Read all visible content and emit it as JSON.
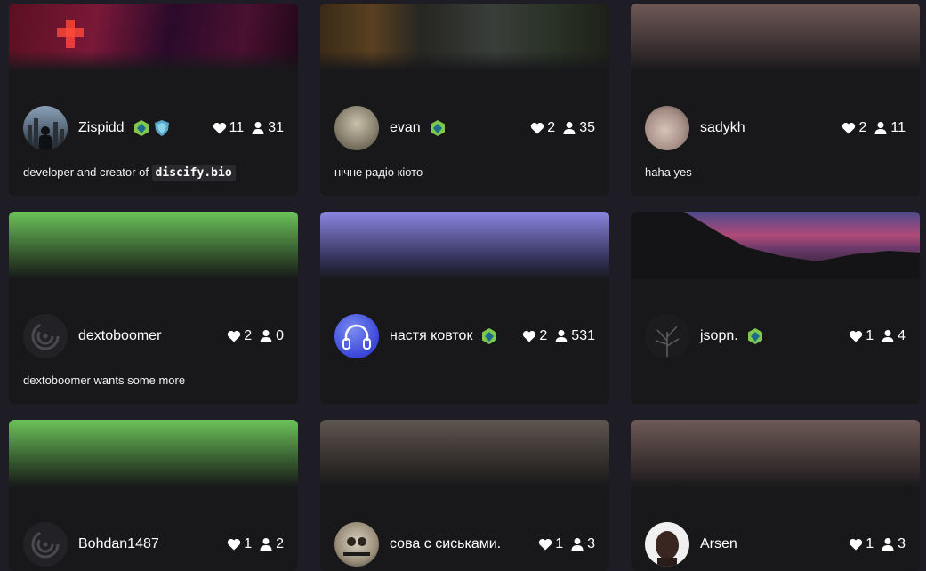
{
  "cards": [
    {
      "username": "Zispidd",
      "likes": "11",
      "followers": "31",
      "bio_prefix": "developer and creator of ",
      "bio_code": "discify.bio",
      "badges": [
        "green-gem-icon",
        "blue-shield-icon"
      ],
      "banner_colors": [
        "#5a1020",
        "#3a0a2a",
        "#200818"
      ]
    },
    {
      "username": "evan",
      "likes": "2",
      "followers": "35",
      "bio": "нічне радіо кіото",
      "badges": [
        "green-gem-icon"
      ],
      "banner_colors": [
        "#3a3024",
        "#2a2a26",
        "#1e2018"
      ]
    },
    {
      "username": "sadykh",
      "likes": "2",
      "followers": "11",
      "bio": "haha yes",
      "badges": [],
      "banner_colors": [
        "#6e5a56"
      ]
    },
    {
      "username": "dextoboomer",
      "likes": "2",
      "followers": "0",
      "bio": "dextoboomer wants some more",
      "badges": [],
      "banner_colors": [
        "#6cc25a"
      ]
    },
    {
      "username": "настя ковток",
      "likes": "2",
      "followers": "531",
      "bio": "",
      "badges": [
        "green-gem-icon"
      ],
      "banner_colors": [
        "#8a86e0"
      ]
    },
    {
      "username": "jsopn.",
      "likes": "1",
      "followers": "4",
      "bio": "",
      "badges": [
        "green-gem-icon"
      ],
      "banner_colors": [
        "#b04a78",
        "#4a4a8a",
        "#101014"
      ]
    },
    {
      "username": "Bohdan1487",
      "likes": "1",
      "followers": "2",
      "bio": "",
      "badges": [],
      "banner_colors": [
        "#6cc25a"
      ]
    },
    {
      "username": "сова с сиськами.",
      "likes": "1",
      "followers": "3",
      "bio": "",
      "badges": [],
      "banner_colors": [
        "#5e5650"
      ]
    },
    {
      "username": "Arsen",
      "likes": "1",
      "followers": "3",
      "bio": "",
      "badges": [],
      "banner_colors": [
        "#6e5a56"
      ]
    }
  ]
}
